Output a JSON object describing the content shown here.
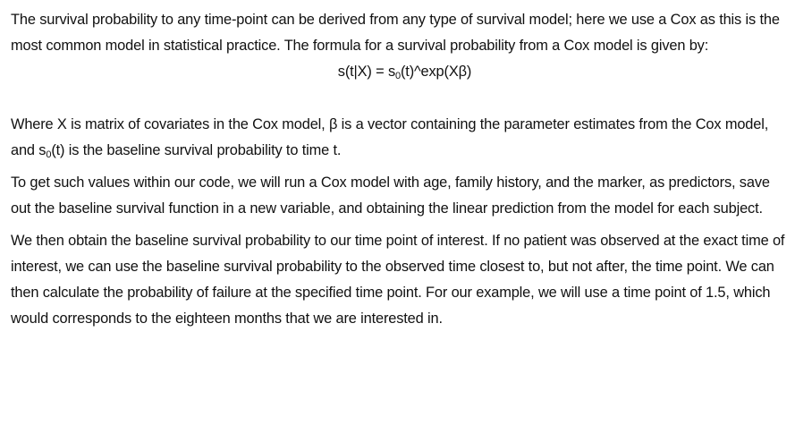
{
  "paragraphs": {
    "p1": "The survival probability to any time-point can be derived from any type of survival model; here we use a Cox as this is the most common model in statistical practice.  The formula for a survival probability from a Cox model is given by:",
    "formula": {
      "lhs": "s(t|X) = s",
      "sub": "0",
      "rhs": "(t)^exp(Xβ)"
    },
    "p2": {
      "part1": "Where X is matrix of covariates in the Cox model, β is a vector containing the parameter estimates from the Cox model, and s",
      "sub": "0",
      "part2": "(t) is the baseline survival probability to time t."
    },
    "p3": "To get such values within our code, we will run a Cox model with age, family history, and the marker, as predictors, save out the baseline survival function in a new variable, and obtaining the linear prediction from the model for each subject.",
    "p4": "We then obtain the baseline survival probability to our time point of interest. If no patient was observed at the exact time of interest, we can use the baseline survival probability to the observed time closest to, but not after, the time point. We can then calculate the probability of failure at the specified time point. For our example, we will use a time point of 1.5, which would corresponds to the eighteen months that we are interested in."
  }
}
